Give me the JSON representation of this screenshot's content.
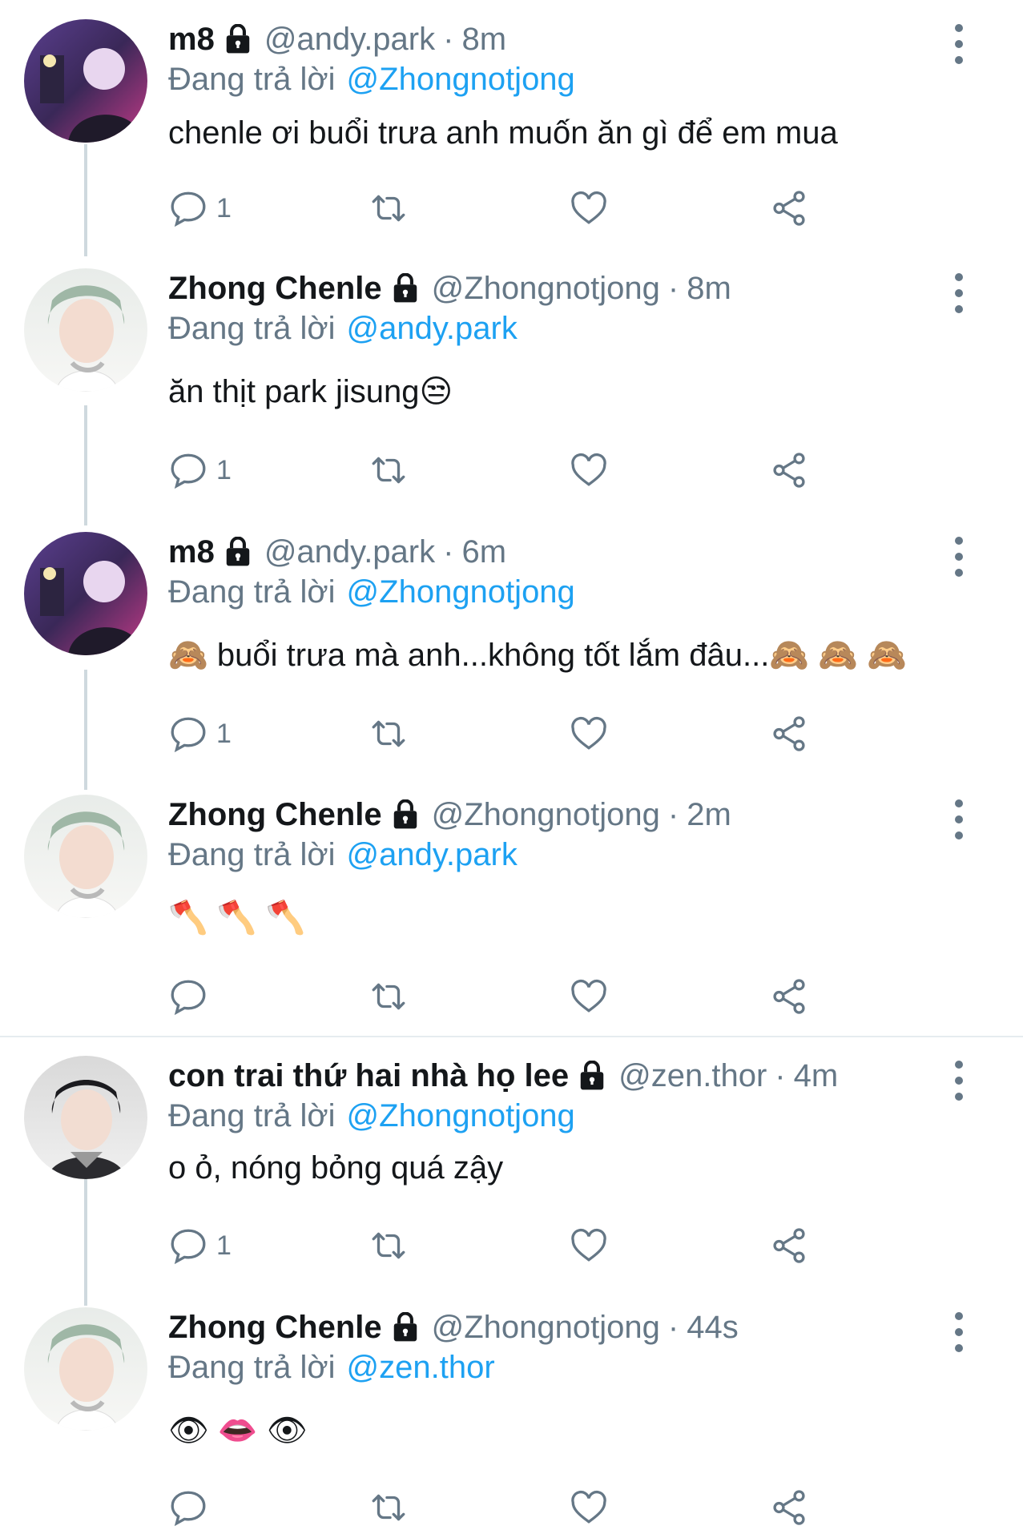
{
  "colors": {
    "accent": "#1da1f2",
    "secondary": "#657786",
    "text": "#14171a"
  },
  "icons": [
    "lock-icon",
    "more-icon",
    "reply-icon",
    "retweet-icon",
    "like-icon",
    "share-icon"
  ],
  "tweets": [
    {
      "name": "m8",
      "handle": "@andy.park",
      "sep": "·",
      "time": "8m",
      "reply_prefix": "Đang trả lời",
      "reply_to": "@Zhongnotjong",
      "text": "chenle ơi buổi trưa anh muốn ăn gì để em mua",
      "reply_count": "1"
    },
    {
      "name": "Zhong Chenle",
      "handle": "@Zhongnotjong",
      "sep": "·",
      "time": "8m",
      "reply_prefix": "Đang trả lời",
      "reply_to": "@andy.park",
      "text": "ăn thịt park jisung😒",
      "reply_count": "1"
    },
    {
      "name": "m8",
      "handle": "@andy.park",
      "sep": "·",
      "time": "6m",
      "reply_prefix": "Đang trả lời",
      "reply_to": "@Zhongnotjong",
      "text": "🙈 buổi trưa mà anh...không tốt lắm đâu...🙈 🙈 🙈",
      "reply_count": "1"
    },
    {
      "name": "Zhong Chenle",
      "handle": "@Zhongnotjong",
      "sep": "·",
      "time": "2m",
      "reply_prefix": "Đang trả lời",
      "reply_to": "@andy.park",
      "text": "🪓 🪓 🪓",
      "reply_count": ""
    },
    {
      "name": "con trai thứ hai nhà họ lee",
      "handle": "@zen.thor",
      "sep": "·",
      "time": "4m",
      "reply_prefix": "Đang trả lời",
      "reply_to": "@Zhongnotjong",
      "text": "o ỏ, nóng bỏng quá zậy",
      "reply_count": "1"
    },
    {
      "name": "Zhong Chenle",
      "handle": "@Zhongnotjong",
      "sep": "·",
      "time": "44s",
      "reply_prefix": "Đang trả lời",
      "reply_to": "@zen.thor",
      "text": "👁 👄 👁",
      "reply_count": ""
    }
  ]
}
